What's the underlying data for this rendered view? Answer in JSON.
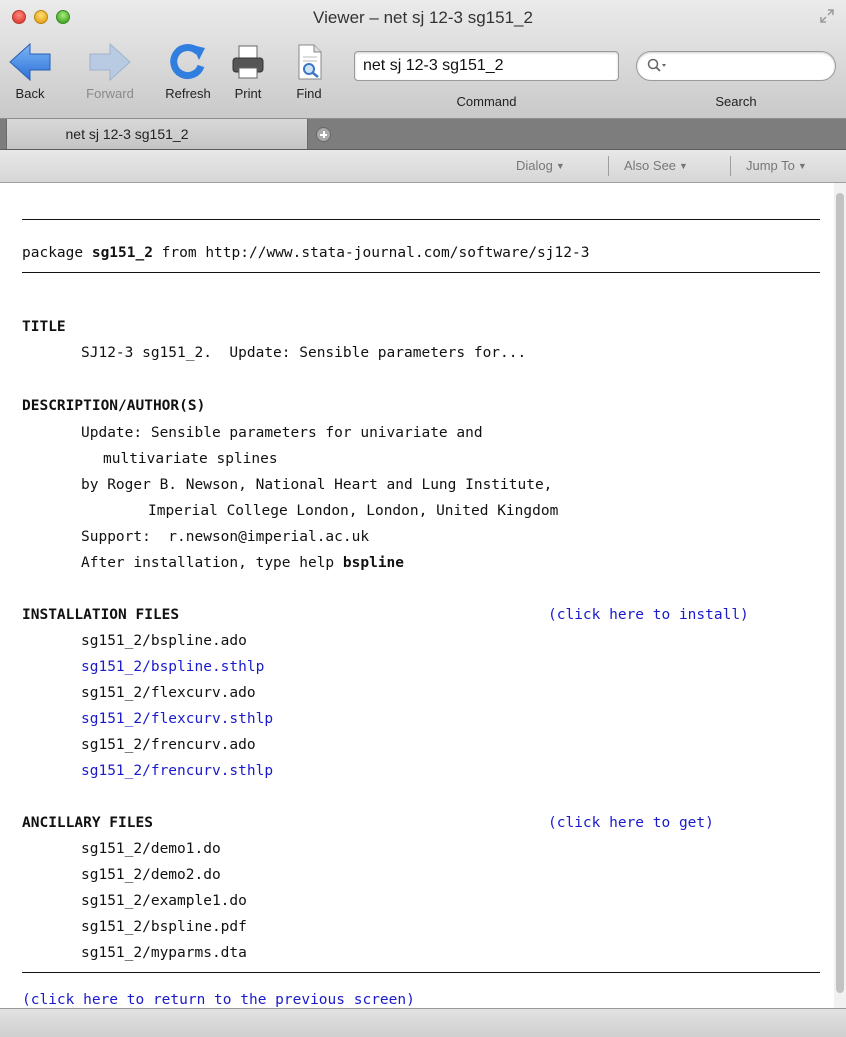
{
  "window": {
    "title": "Viewer – net sj 12-3 sg151_2"
  },
  "toolbar": {
    "back": "Back",
    "forward": "Forward",
    "refresh": "Refresh",
    "print": "Print",
    "find": "Find",
    "command_value": "net sj 12-3 sg151_2",
    "command_label": "Command",
    "search_label": "Search"
  },
  "tabs": [
    {
      "label": "net sj 12-3 sg151_2"
    }
  ],
  "menubar": {
    "dialog": "Dialog",
    "also_see": "Also See",
    "jump_to": "Jump To"
  },
  "content": {
    "package_prefix": "package ",
    "package_name": "sg151_2",
    "package_suffix": " from http://www.stata-journal.com/software/sj12-3",
    "title_heading": "TITLE",
    "title_text": "SJ12-3 sg151_2.  Update: Sensible parameters for...",
    "desc_heading": "DESCRIPTION/AUTHOR(S)",
    "desc_lines": [
      "Update: Sensible parameters for univariate and",
      "multivariate splines",
      "by Roger B. Newson, National Heart and Lung Institute,",
      "Imperial College London, London, United Kingdom",
      "Support:  r.newson@imperial.ac.uk",
      "After installation, type help "
    ],
    "desc_help_cmd": "bspline",
    "install_heading": "INSTALLATION FILES",
    "install_link": "(click here to install)",
    "install_files": [
      {
        "name": "sg151_2/bspline.ado",
        "link": false
      },
      {
        "name": "sg151_2/bspline.sthlp",
        "link": true
      },
      {
        "name": "sg151_2/flexcurv.ado",
        "link": false
      },
      {
        "name": "sg151_2/flexcurv.sthlp",
        "link": true
      },
      {
        "name": "sg151_2/frencurv.ado",
        "link": false
      },
      {
        "name": "sg151_2/frencurv.sthlp",
        "link": true
      }
    ],
    "anc_heading": "ANCILLARY FILES",
    "anc_link": "(click here to get)",
    "anc_files": [
      "sg151_2/demo1.do",
      "sg151_2/demo2.do",
      "sg151_2/example1.do",
      "sg151_2/bspline.pdf",
      "sg151_2/myparms.dta"
    ],
    "return_link": "(click here to return to the previous screen)"
  }
}
